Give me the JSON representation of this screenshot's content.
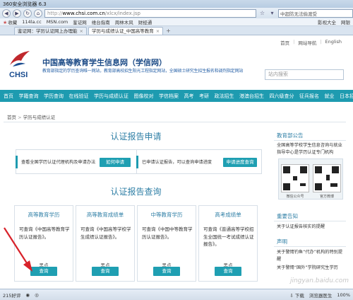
{
  "browser": {
    "title": "360安全浏览器 6.3",
    "url_scheme": "http://",
    "url_domain": "www.chsi.com.cn",
    "url_path": "/xlcx/index.jsp",
    "search_text": "中超防无法偷渡受",
    "favorites": [
      "收藏",
      "114la.cc",
      "MSN.com",
      "鉴证网",
      "维台指南",
      "周林木风",
      "财经通"
    ],
    "favorites_right": [
      "影视大全",
      "网银"
    ],
    "tabs": [
      {
        "label": "鉴证网：学历认证网上办理能"
      },
      {
        "label": "学历与成绩认证_中国高等教育"
      }
    ],
    "status": {
      "left": "215好评",
      "download": "下载",
      "accelerate": "浏览器医生",
      "zoom": "100%"
    }
  },
  "site": {
    "utility": [
      "首页",
      "网站导航",
      "English",
      "English"
    ],
    "logo_text": "CHSI",
    "title": "中国高等教育学生信息网（学信网）",
    "slogan": "教育部指定的学历查询唯一网站，教育部高校招生阳光工程指定网站，全国硕士研究生招生报名和调剂指定网站",
    "search_placeholder": "站内搜索",
    "nav": [
      "首页",
      "学籍查询",
      "学历查询",
      "在线验证",
      "学历与成绩认证",
      "图像校对",
      "学信档案",
      "高考",
      "考研",
      "政法招生",
      "港澳台招生",
      "四六级查分",
      "征兵报名",
      "就业",
      "日本招生"
    ],
    "breadcrumb": [
      "首页",
      "学历与成绩认证"
    ]
  },
  "main": {
    "apply_heading": "认证报告申请",
    "apply_left_text": "查看全国学历认证代理机构及申请办法",
    "apply_left_button": "如何申请",
    "apply_right_text": "已申请认证报告，可以查询申请进度",
    "apply_right_button": "申请进度查询",
    "query_heading": "认证报告查询",
    "cards": [
      {
        "title": "高等教育学历",
        "desc": "可查询《中国高等教育学历认证报告》。",
        "sub": "黑点",
        "button": "查询"
      },
      {
        "title": "高等教育成绩单",
        "desc": "可查询《中国高等学校学生成绩认证报告》。",
        "sub": "黑点",
        "button": "查询"
      },
      {
        "title": "中等教育学历",
        "desc": "可查询《中国中等教育学历认证报告》。",
        "sub": "黑点",
        "button": "查询"
      },
      {
        "title": "高考成绩单",
        "desc": "可查询《普通高等学校招生全国统一考试成绩认证报告》。",
        "sub": "黑点",
        "button": "查询"
      }
    ]
  },
  "sidebar": {
    "notice_heading": "教育部公告",
    "notice_text": "全国高等学校学生信息咨询与就业指导中心是学历认证专门机构",
    "qr_captions": [
      "微信公众号",
      "官方微博"
    ],
    "important_heading": "重要告知",
    "important_text": "关于认证报告核实的提醒",
    "statement_heading": "声明",
    "statement_text": "关于警惕钓鱼“代办”机构的特别提醒",
    "statement_text2": "关于警惕“国外”学院研究生学历"
  },
  "watermark": "jingyan.baidu.com"
}
